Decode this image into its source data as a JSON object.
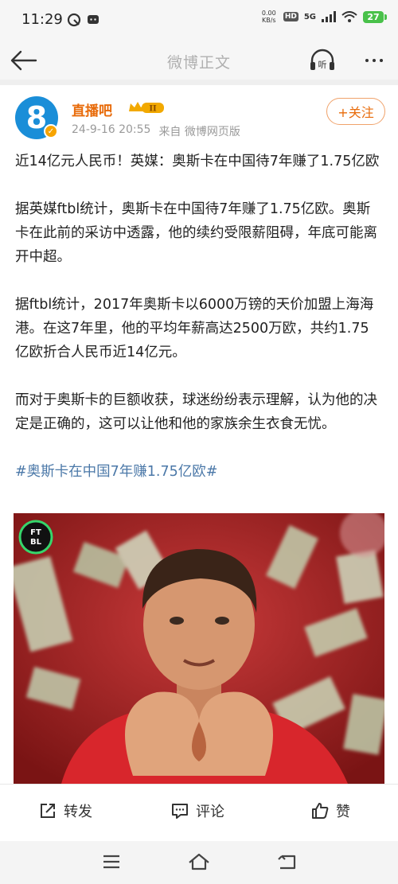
{
  "status_bar": {
    "time": "11:29",
    "net_speed_value": "0.00",
    "net_speed_unit": "KB/s",
    "hd_label": "HD",
    "network_label": "5G",
    "battery": "27"
  },
  "header": {
    "title": "微博正文",
    "listen_label": "听"
  },
  "post": {
    "author_name": "直播吧",
    "vip_level": "II",
    "date": "24-9-16 20:55",
    "source": "来自 微博网页版",
    "follow_label": "+关注",
    "paragraphs": [
      "近14亿元人民币！英媒：奥斯卡在中国待7年赚了1.75亿欧",
      "据英媒ftbl统计，奥斯卡在中国待7年赚了1.75亿欧。奥斯卡在此前的采访中透露，他的续约受限薪阻碍，年底可能离开中超。",
      "据ftbl统计，2017年奥斯卡以6000万镑的天价加盟上海海港。在这7年里，他的平均年薪高达2500万欧，共约1.75亿欧折合人民币近14亿元。",
      "而对于奥斯卡的巨额收获，球迷纷纷表示理解，认为他的决定是正确的，这可以让他和他的家族余生衣食无忧。"
    ],
    "hashtag": "#奥斯卡在中国7年赚1.75亿欧#",
    "image_logo_top": "FT",
    "image_logo_bottom": "BL"
  },
  "actions": {
    "repost": "转发",
    "comment": "评论",
    "like": "赞"
  },
  "colors": {
    "accent_orange": "#e86b0a",
    "hashtag_blue": "#4b78a8",
    "avatar_blue": "#1a8ed8"
  }
}
